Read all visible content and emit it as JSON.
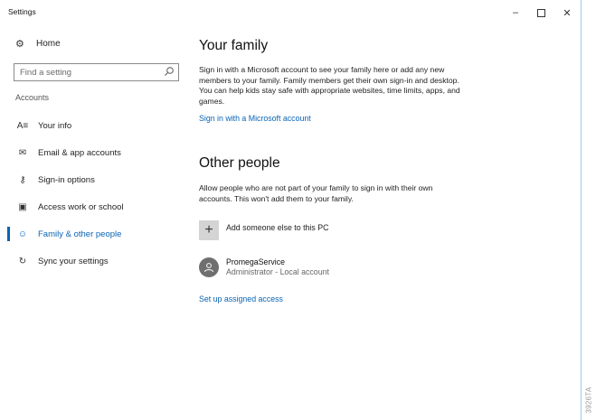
{
  "window": {
    "title": "Settings",
    "minimize_glyph": "–",
    "close_glyph": "✕"
  },
  "sidebar": {
    "home_label": "Home",
    "home_icon": "gear-icon",
    "search": {
      "placeholder": "Find a setting",
      "value": ""
    },
    "section_label": "Accounts",
    "items": [
      {
        "label": "Your info",
        "icon": "person-card-icon",
        "glyph": "A≡",
        "selected": false
      },
      {
        "label": "Email & app accounts",
        "icon": "mail-icon",
        "glyph": "✉",
        "selected": false
      },
      {
        "label": "Sign-in options",
        "icon": "key-icon",
        "glyph": "⚷",
        "selected": false
      },
      {
        "label": "Access work or school",
        "icon": "briefcase-icon",
        "glyph": "▣",
        "selected": false
      },
      {
        "label": "Family & other people",
        "icon": "people-icon",
        "glyph": "☺",
        "selected": true
      },
      {
        "label": "Sync your settings",
        "icon": "sync-icon",
        "glyph": "↻",
        "selected": false
      }
    ]
  },
  "main": {
    "family": {
      "heading": "Your family",
      "description": "Sign in with a Microsoft account to see your family here or add any new members to your family. Family members get their own sign-in and desktop. You can help kids stay safe with appropriate websites, time limits, apps, and games.",
      "link": "Sign in with a Microsoft account"
    },
    "other": {
      "heading": "Other people",
      "description": "Allow people who are not part of your family to sign in with their own accounts. This won't add them to your family.",
      "add_label": "Add someone else to this PC",
      "user_name": "PromegaService",
      "user_role": "Administrator - Local account",
      "assigned_access_link": "Set up assigned access"
    }
  },
  "watermark": "3926TA",
  "colors": {
    "accent": "#0a64b4",
    "tile": "#d4d4d4",
    "avatar": "#6f6f6f"
  }
}
